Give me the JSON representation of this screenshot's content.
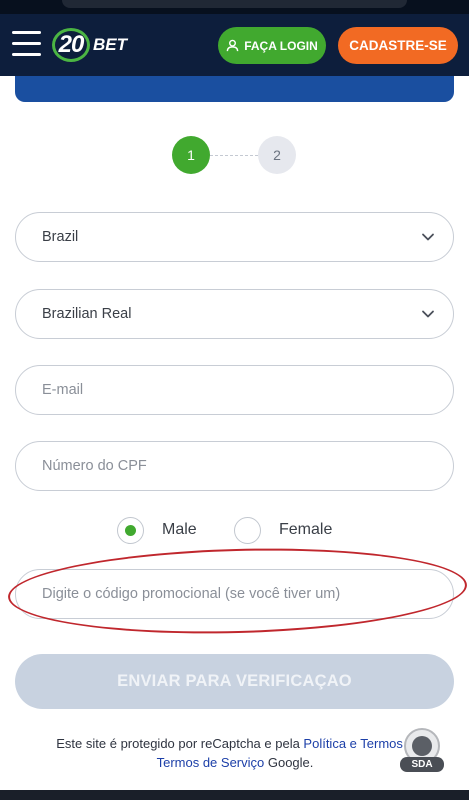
{
  "header": {
    "logo_number": "20",
    "logo_word": "BET",
    "login_label": "FAÇA LOGIN",
    "signup_label": "CADASTRE-SE"
  },
  "steps": [
    "1",
    "2"
  ],
  "form": {
    "country": "Brazil",
    "currency": "Brazilian Real",
    "email_placeholder": "E-mail",
    "cpf_placeholder": "Número do CPF",
    "gender_options": [
      "Male",
      "Female"
    ],
    "gender_selected": "Male",
    "promo_placeholder": "Digite o código promocional (se você tiver um)",
    "submit_label": "ENVIAR PARA VERIFICAÇAO"
  },
  "footer": {
    "text_before": "Este site é protegido por reCaptcha e pela ",
    "privacy_link": "Política e Termos",
    "text_between": " e",
    "terms_link": "Termos de Serviço",
    "text_after": " Google."
  },
  "watermark": {
    "label": "SDA"
  },
  "colors": {
    "header_bg": "#0d1e3c",
    "login_green": "#41a92f",
    "signup_orange": "#f26a23",
    "banner_blue": "#1a4fa0",
    "submit_disabled": "#c8d2e0",
    "link_blue": "#1c3fa8",
    "annotation_red": "#c0272d"
  },
  "icons": {
    "menu": "hamburger-menu-icon",
    "login": "user-icon",
    "dropdown": "chevron-down-icon"
  }
}
